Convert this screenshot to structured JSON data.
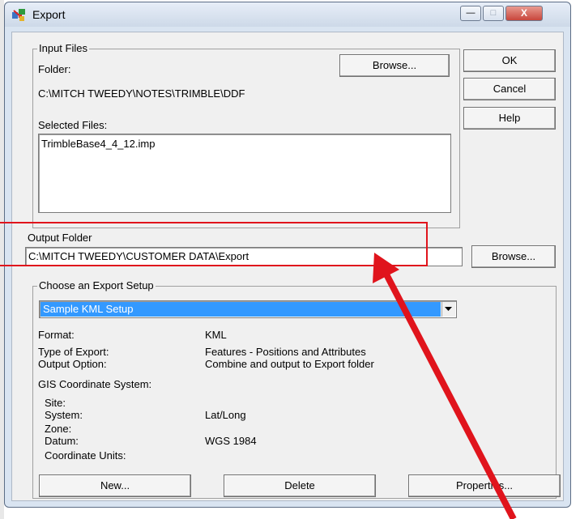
{
  "window": {
    "title": "Export",
    "minimize_glyph": "—",
    "maximize_glyph": "□",
    "close_glyph": "X"
  },
  "input_files": {
    "group_title": "Input Files",
    "folder_label": "Folder:",
    "folder_path": "C:\\MITCH TWEEDY\\NOTES\\TRIMBLE\\DDF",
    "browse_label": "Browse...",
    "selected_label": "Selected Files:",
    "files": [
      "TrimbleBase4_4_12.imp"
    ]
  },
  "buttons": {
    "ok": "OK",
    "cancel": "Cancel",
    "help": "Help"
  },
  "output": {
    "label": "Output Folder",
    "path": "C:\\MITCH TWEEDY\\CUSTOMER DATA\\Export",
    "browse_label": "Browse..."
  },
  "export_setup": {
    "group_title": "Choose an Export Setup",
    "selected": "Sample KML Setup",
    "details": {
      "format_label": "Format:",
      "format_value": "KML",
      "type_label": "Type of Export:",
      "type_value": "Features - Positions and Attributes",
      "option_label": "Output Option:",
      "option_value": "Combine and output to Export folder",
      "gis_label": "GIS Coordinate System:",
      "site_label": "Site:",
      "system_label": "System:",
      "system_value": "Lat/Long",
      "zone_label": "Zone:",
      "datum_label": "Datum:",
      "datum_value": "WGS 1984",
      "units_label": "Coordinate Units:"
    },
    "new_label": "New...",
    "delete_label": "Delete",
    "properties_label": "Properties..."
  },
  "colors": {
    "highlight": "#3399ff",
    "annotation_red": "#e0141c",
    "close_button": "#c8463c"
  },
  "icons": {
    "app": "export-app-icon",
    "dropdown": "dropdown-arrow-icon"
  }
}
